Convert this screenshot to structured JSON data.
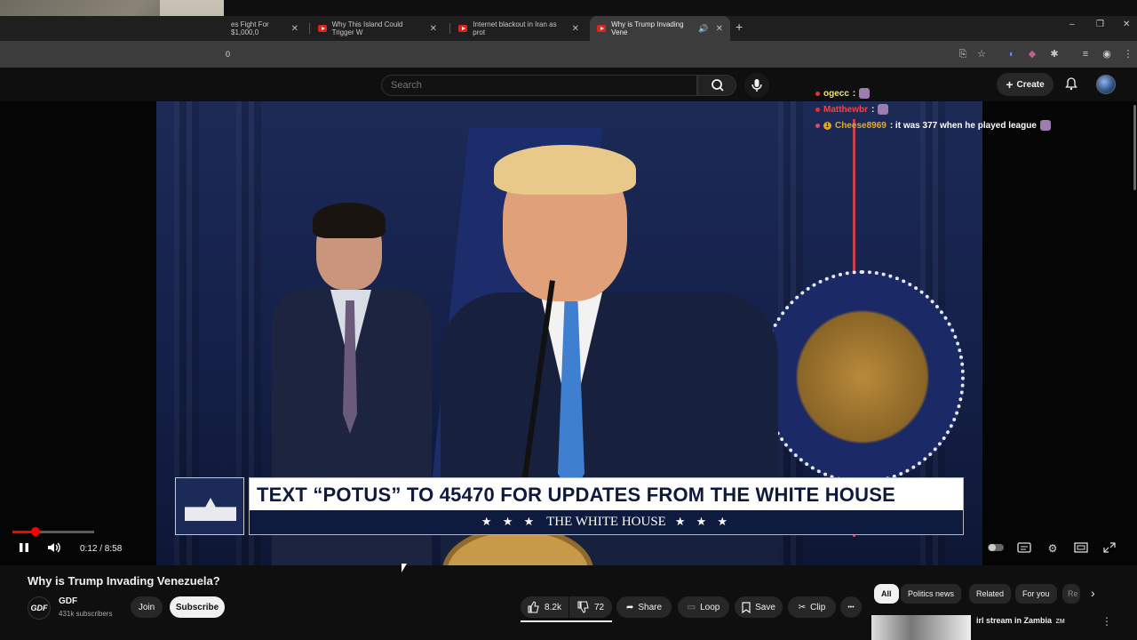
{
  "browser": {
    "tabs": [
      {
        "label": "es Fight For $1,000,0",
        "active": false
      },
      {
        "label": "Why This Island Could Trigger W",
        "active": false
      },
      {
        "label": "Internet blackout in Iran as prot",
        "active": false
      },
      {
        "label": "Why is Trump Invading Vene",
        "active": true
      }
    ],
    "url": "0",
    "new_tab": "+",
    "window_controls": [
      "–",
      "❐",
      "✕"
    ]
  },
  "youtube": {
    "search_placeholder": "Search",
    "create_label": "Create"
  },
  "chat": [
    {
      "user": "ogecc",
      "message": ""
    },
    {
      "user": "Matthewbr",
      "message": ""
    },
    {
      "user": "Cheese8969",
      "message": ": it was 377 when he played league"
    }
  ],
  "video": {
    "banner_text": "TEXT “POTUS” TO 45470 FOR UPDATES FROM THE WHITE HOUSE",
    "banner_strip": "THE WHITE HOUSE",
    "banner_stars": "★ ★ ★",
    "time": "0:12 / 8:58",
    "progress": 0.0223
  },
  "meta": {
    "title": "Why is Trump Invading Venezuela?",
    "channel_logo": "GDF",
    "channel": "GDF",
    "subscribers": "431k subscribers",
    "join": "Join",
    "subscribe": "Subscribe",
    "likes": "8.2k",
    "dislikes": "72",
    "share": "Share",
    "loop": "Loop",
    "save": "Save",
    "clip": "Clip",
    "more": "•••"
  },
  "chips": [
    {
      "label": "All",
      "active": true
    },
    {
      "label": "Politics news",
      "active": false
    },
    {
      "label": "Related",
      "active": false
    },
    {
      "label": "For you",
      "active": false
    },
    {
      "label": "Re",
      "active": false
    }
  ],
  "recommended": {
    "title": "irl stream in Zambia",
    "flag": "ZM"
  },
  "colors": {
    "accent": "#ff0000",
    "background": "#0f0f0f",
    "banner_navy": "#0e1a3e"
  }
}
